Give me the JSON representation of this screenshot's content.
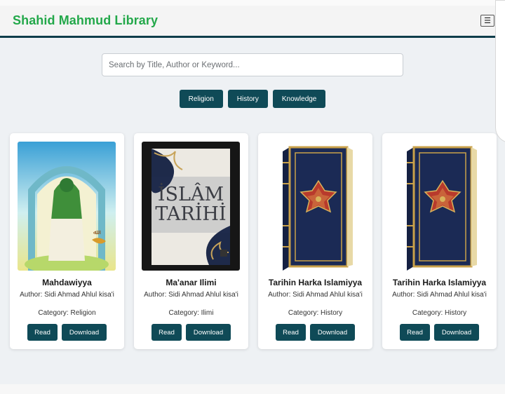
{
  "header": {
    "title": "Shahid Mahmud Library",
    "menu_icon": "☰"
  },
  "search": {
    "placeholder": "Search by Title, Author or Keyword...",
    "value": ""
  },
  "categories": [
    "Religion",
    "History",
    "Knowledge"
  ],
  "books": [
    {
      "title": "Mahdawiyya",
      "author": "Author: Sidi Ahmad Ahlul kisa'i",
      "category": "Category: Religion",
      "read": "Read",
      "download": "Download",
      "cover": "figure-mosque-cover"
    },
    {
      "title": "Ma'anar Ilimi",
      "author": "Author: Sidi Ahmad Ahlul kisa'i",
      "category": "Category: Ilimi",
      "read": "Read",
      "download": "Download",
      "cover": "islam-tarihi-cover"
    },
    {
      "title": "Tarihin Harka Islamiyya",
      "author": "Author: Sidi Ahmad Ahlul kisa'i",
      "category": "Category: History",
      "read": "Read",
      "download": "Download",
      "cover": "ornate-blue-book-cover"
    },
    {
      "title": "Tarihin Harka Islamiyya",
      "author": "Author: Sidi Ahmad Ahlul kisa'i",
      "category": "Category: History",
      "read": "Read",
      "download": "Download",
      "cover": "ornate-blue-book-cover"
    }
  ],
  "colors": {
    "brand": "#23a84a",
    "primary": "#0f4a57",
    "background": "#eef1f4"
  }
}
